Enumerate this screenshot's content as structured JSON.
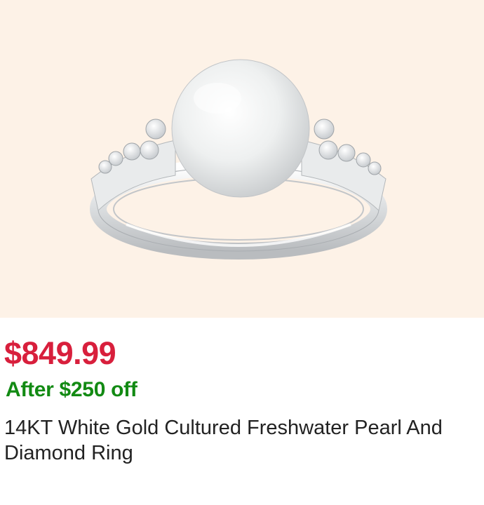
{
  "product": {
    "image_alt": "pearl-diamond-ring",
    "price": "$849.99",
    "discount_text": "After $250 off",
    "title": "14KT White Gold Cultured Freshwater Pearl And Diamond Ring"
  },
  "colors": {
    "image_background": "#fdf2e7",
    "price": "#d81f3c",
    "discount": "#128a13",
    "title": "#222222"
  }
}
